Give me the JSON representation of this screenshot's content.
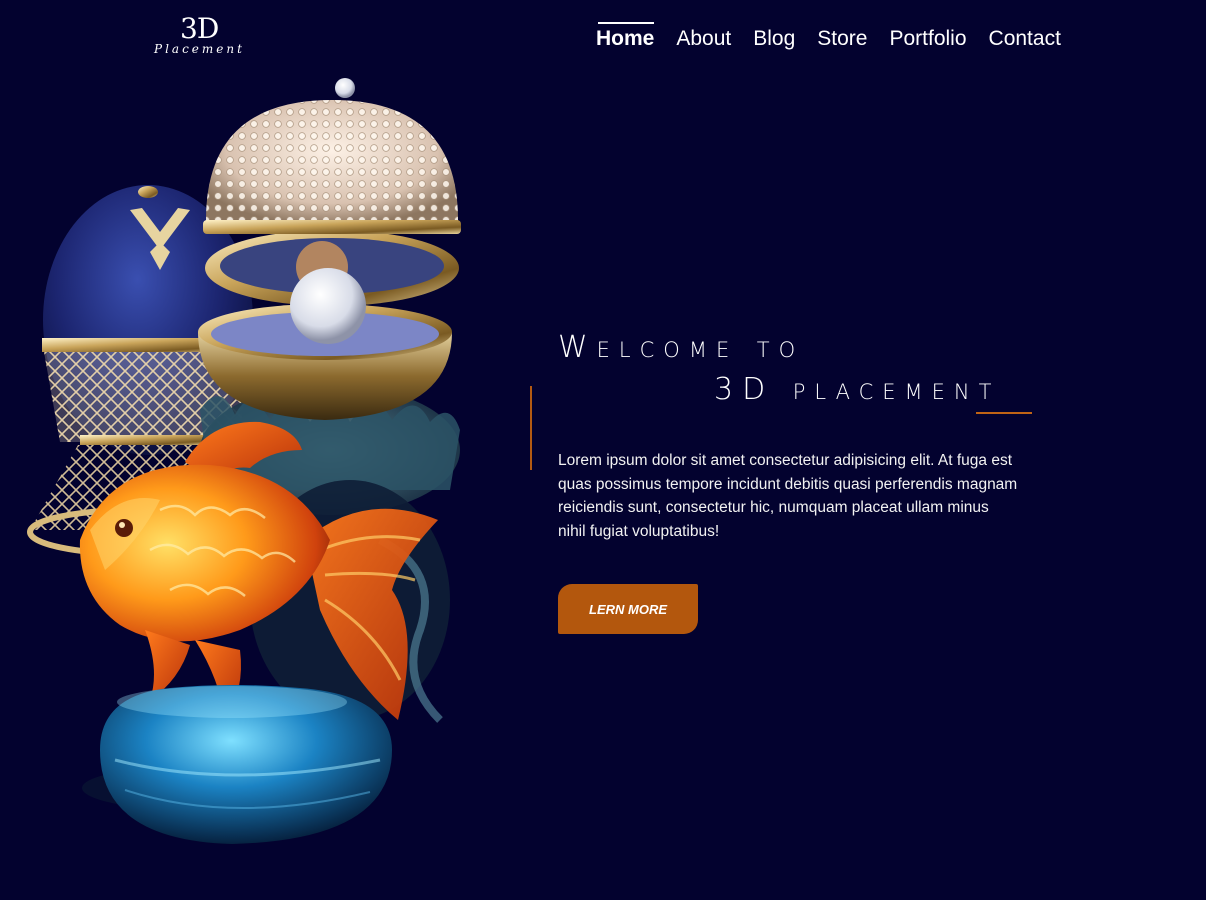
{
  "logo": {
    "main": "3D",
    "sub": "Placement"
  },
  "nav": {
    "items": [
      {
        "label": "Home",
        "active": true
      },
      {
        "label": "About"
      },
      {
        "label": "Blog"
      },
      {
        "label": "Store"
      },
      {
        "label": "Portfolio"
      },
      {
        "label": "Contact"
      }
    ]
  },
  "hero": {
    "heading_line1": "Welcome to",
    "heading_line2": "3D placement",
    "body": "Lorem ipsum dolor sit amet consectetur adipisicing elit. At fuga est quas possimus tempore incidunt debitis quasi perferendis magnam reiciendis sunt, consectetur hic, numquam placeat ullam minus nihil fugiat voluptatibus!",
    "cta_label": "LERN MORE",
    "art": [
      "jeweled-egg",
      "pearl-shell-egg",
      "glass-goldfish",
      "glass-pebble"
    ]
  },
  "colors": {
    "background": "#03022f",
    "accent": "#b3570d",
    "text": "#ffffff"
  }
}
